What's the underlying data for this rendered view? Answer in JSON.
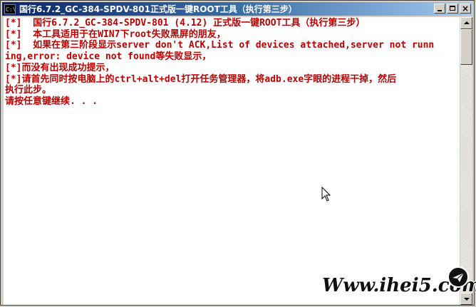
{
  "window": {
    "icon_label": "C:\\",
    "title": "国行6.7.2_GC-384-SPDV-801正式版一键ROOT工具（执行第三步）",
    "buttons": [
      "minimize",
      "maximize",
      "close"
    ]
  },
  "console": {
    "text_color": "#c00000",
    "background": "#ffffff",
    "lines": [
      "[*]  国行6.7.2_GC-384-SPDV-801 (4.12) 正式版一键ROOT工具（执行第三步）",
      "[*]  本工具适用于在WIN7下root失败黑屏的朋友，",
      "[*]  如果在第三阶段显示server don't ACK,List of devices attached,server not runn",
      "ing,error: device not found等失败显示，",
      "[*]而没有出现成功提示，",
      "[*]请首先同时按电脑上的ctrl+alt+del打开任务管理器，将adb.exe字眼的进程干掉，然后",
      "执行此步。",
      "请按任意键继续. . ."
    ]
  },
  "watermark": {
    "text": "Www.ihei5.com"
  },
  "icons": {
    "app": "console-icon",
    "cursor": "mouse-pointer-icon",
    "scroll_up": "arrow-up-icon",
    "scroll_down": "arrow-down-icon"
  }
}
